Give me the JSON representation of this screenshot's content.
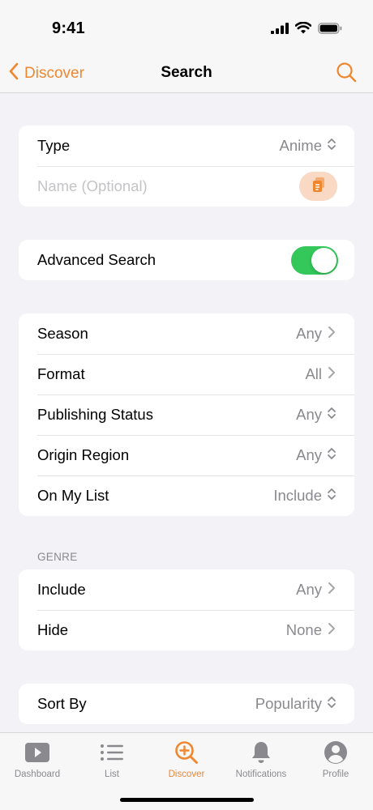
{
  "status_bar": {
    "time": "9:41"
  },
  "nav": {
    "back_label": "Discover",
    "title": "Search"
  },
  "type_card": {
    "type_label": "Type",
    "type_value": "Anime",
    "name_placeholder": "Name (Optional)"
  },
  "advanced_card": {
    "label": "Advanced Search",
    "enabled": true
  },
  "filters_card": {
    "rows": [
      {
        "label": "Season",
        "value": "Any",
        "accessory": "chevron-right"
      },
      {
        "label": "Format",
        "value": "All",
        "accessory": "chevron-right"
      },
      {
        "label": "Publishing Status",
        "value": "Any",
        "accessory": "chevron-updown"
      },
      {
        "label": "Origin Region",
        "value": "Any",
        "accessory": "chevron-updown"
      },
      {
        "label": "On My List",
        "value": "Include",
        "accessory": "chevron-updown"
      }
    ]
  },
  "genre_section": {
    "header": "GENRE",
    "rows": [
      {
        "label": "Include",
        "value": "Any",
        "accessory": "chevron-right"
      },
      {
        "label": "Hide",
        "value": "None",
        "accessory": "chevron-right"
      }
    ]
  },
  "sort_card": {
    "label": "Sort By",
    "value": "Popularity",
    "accessory": "chevron-updown"
  },
  "tab_bar": {
    "items": [
      {
        "label": "Dashboard",
        "icon": "play-rectangle-icon",
        "active": false
      },
      {
        "label": "List",
        "icon": "list-icon",
        "active": false
      },
      {
        "label": "Discover",
        "icon": "magnifier-plus-icon",
        "active": true
      },
      {
        "label": "Notifications",
        "icon": "bell-icon",
        "active": false
      },
      {
        "label": "Profile",
        "icon": "person-circle-icon",
        "active": false
      }
    ]
  },
  "colors": {
    "accent": "#f0862e",
    "toggle_on": "#34c759",
    "background": "#f2f2f7",
    "secondary_text": "#8a8a8e"
  }
}
